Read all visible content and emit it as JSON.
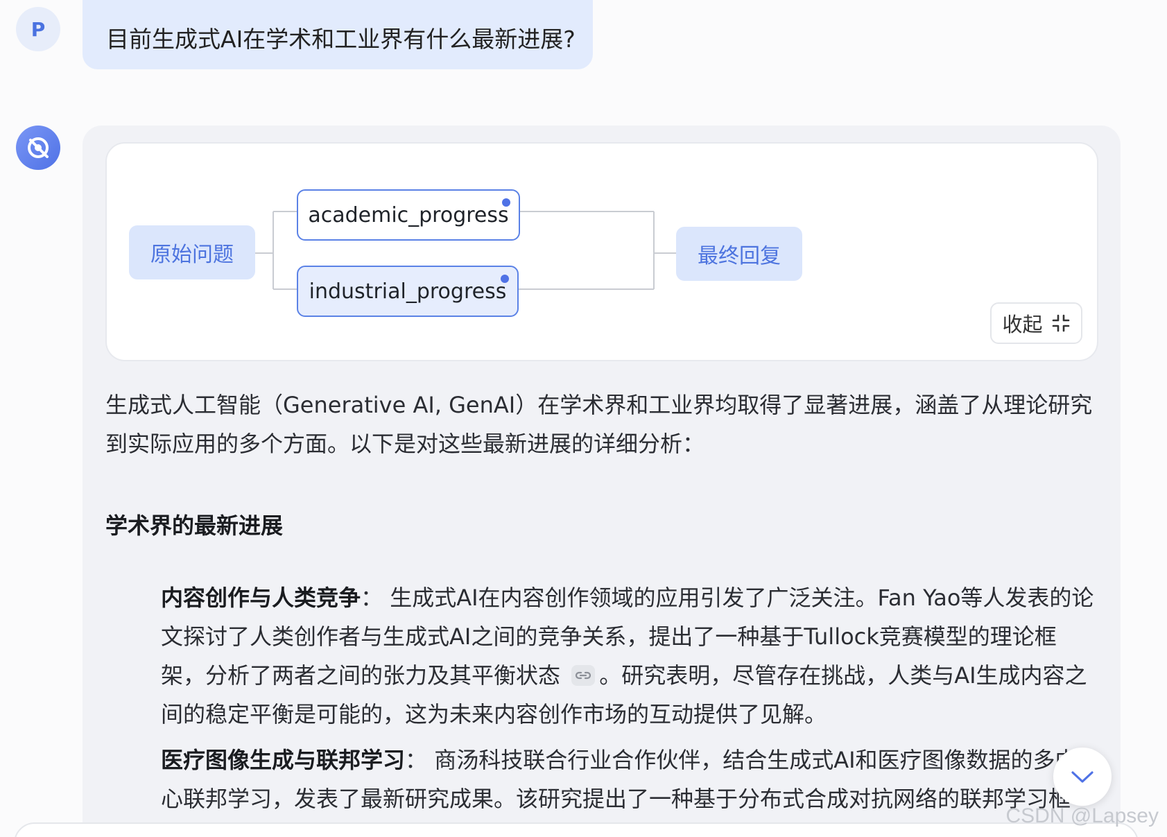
{
  "user": {
    "avatar_letter": "P",
    "message": "目前生成式AI在学术和工业界有什么最新进展?"
  },
  "bot": {
    "avatar_icon": "assistant-logo-icon"
  },
  "graph": {
    "start_node": "原始问题",
    "branches": [
      "academic_progress",
      "industrial_progress"
    ],
    "end_node": "最终回复",
    "collapse_label": "收起",
    "collapse_icon": "collapse-arrows-icon"
  },
  "answer": {
    "intro": "生成式人工智能（Generative AI, GenAI）在学术界和工业界均取得了显著进展，涵盖了从理论研究到实际应用的多个方面。以下是对这些最新进展的详细分析：",
    "section_title": "学术界的最新进展",
    "items": [
      {
        "title": "内容创作与人类竞争",
        "sep": "：",
        "text_a": "生成式AI在内容创作领域的应用引发了广泛关注。Fan Yao等人发表的论文探讨了人类创作者与生成式AI之间的竞争关系，提出了一种基于Tullock竞赛模型的理论框架，分析了两者之间的张力及其平衡状态",
        "text_b": "。研究表明，尽管存在挑战，人类与AI生成内容之间的稳定平衡是可能的，这为未来内容创作市场的互动提供了见解。"
      },
      {
        "title": "医疗图像生成与联邦学习",
        "sep": "：",
        "text_a": "商汤科技联合行业合作伙伴，结合生成式AI和医疗图像数据的多中心联邦学习，发表了最新研究成果。该研究提出了一种基于分布式合成对抗网络的联邦学习框",
        "text_b": ""
      }
    ]
  },
  "watermark": "CSDN @Lapsey",
  "colors": {
    "accent": "#4f72e6",
    "user_bubble": "#e2ebfd",
    "bot_card": "#f1f2f6"
  }
}
